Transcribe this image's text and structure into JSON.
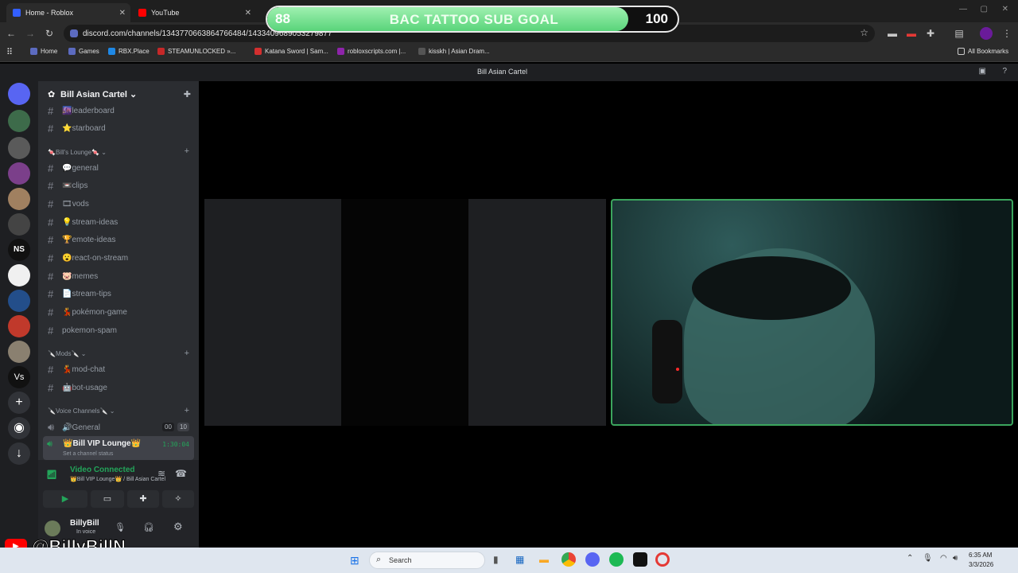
{
  "browser": {
    "tabs": [
      {
        "title": "Home - Roblox",
        "color": "#335fff"
      },
      {
        "title": "YouTube",
        "color": "#ff0000"
      }
    ],
    "url": "discord.com/channels/1343770663864766484/1433409689053279877",
    "bookmarks": [
      {
        "label": "Home",
        "color": "#5c6bc0"
      },
      {
        "label": "Games",
        "color": "#5c6bc0"
      },
      {
        "label": "RBX.Place",
        "color": "#1e88e5"
      },
      {
        "label": "STEAMUNLOCKED »...",
        "color": "#c62828"
      },
      {
        "label": "Katana Sword | Sam...",
        "color": "#d32f2f"
      },
      {
        "label": "robloxscripts.com |...",
        "color": "#8e24aa"
      },
      {
        "label": "kisskh | Asian Dram...",
        "color": "#555555"
      }
    ],
    "all_bookmarks": "All Bookmarks"
  },
  "subgoal": {
    "current": "88",
    "label": "BAC TATTOO SUB GOAL",
    "goal": "100",
    "progress": 0.88
  },
  "discord": {
    "window_title": "Bill Asian Cartel",
    "server_name": "Bill Asian Cartel",
    "channels": [
      {
        "name": "🌆leaderboard"
      },
      {
        "name": "⭐starboard"
      }
    ],
    "lounge_category": "🍬Bill's Lounge🍬",
    "lounge_channels": [
      {
        "name": "💬general"
      },
      {
        "name": "📼clips"
      },
      {
        "name": "🎞vods"
      },
      {
        "name": "💡stream-ideas"
      },
      {
        "name": "🏆emote-ideas"
      },
      {
        "name": "😮react-on-stream"
      },
      {
        "name": "🐷memes"
      },
      {
        "name": "📄stream-tips"
      },
      {
        "name": "💃pokémon-game"
      },
      {
        "name": "pokemon-spam"
      }
    ],
    "mods_category": "🔪Mods🔪",
    "mods_channels": [
      {
        "name": "💃mod-chat"
      },
      {
        "name": "🤖bot-usage"
      }
    ],
    "voice_category": "🔪Voice Channels🔪",
    "voice_general": "🔊General",
    "voice_general_counts": [
      "00",
      "10"
    ],
    "vip_lounge": "👑Bill VIP Lounge👑",
    "vip_timer": "1:30:04",
    "vip_status": "Set a channel status",
    "connection": {
      "status": "Video Connected",
      "location": "👑Bill VIP Lounge👑 / Bill Asian Cartel"
    },
    "user": {
      "name": "BillyBill",
      "status": "In voice"
    }
  },
  "overlay_handle": "@BillyBillN",
  "taskbar": {
    "search_placeholder": "Search",
    "time": "6:35 AM",
    "date": "3/3/2026"
  }
}
